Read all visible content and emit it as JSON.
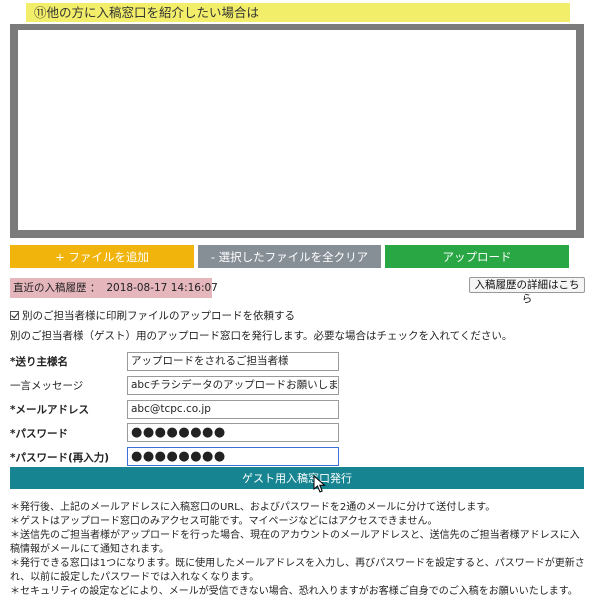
{
  "section": {
    "title": "⑪他の方に入稿窓口を紹介したい場合は"
  },
  "buttons": {
    "add_file": "+ ファイルを追加",
    "clear_selected": "- 選択したファイルを全クリア",
    "upload": "アップロード"
  },
  "recent": {
    "label": "直近の入稿履歴 ：",
    "timestamp": "2018-08-17 14:16:07",
    "details_button": "入稿履歴の詳細はこちら"
  },
  "request": {
    "checkbox_label": "別のご担当者様に印刷ファイルのアップロードを依頼する",
    "checked": true,
    "description": "別のご担当者様（ゲスト）用のアップロード窓口を発行します。必要な場合はチェックを入れてください。"
  },
  "form": {
    "sender_name": {
      "label": "*送り主様名",
      "value": "アップロードをされるご担当者様"
    },
    "message": {
      "label": "一言メッセージ",
      "value": "abcチラシデータのアップロードお願いします"
    },
    "email": {
      "label": "*メールアドレス",
      "value": "abc@tcpc.co.jp"
    },
    "password": {
      "label": "*パスワード",
      "value": "●●●●●●●●"
    },
    "password_confirm": {
      "label": "*パスワード(再入力)",
      "value": "●●●●●●●●"
    }
  },
  "guest_button": "ゲスト用入稿窓口発行",
  "notes": [
    "＊発行後、上記のメールアドレスに入稿窓口のURL、およびパスワードを2通のメールに分けて送付します。",
    "＊ゲストはアップロード窓口のみアクセス可能です。マイページなどにはアクセスできません。",
    "＊送信先のご担当者様がアップロードを行った場合、現在のアカウントのメールアドレスと、送信先のご担当者様アドレスに入稿情報がメールにて通知されます。",
    "＊発行できる窓口は1つになります。既に使用したメールアドレスを入力し、再びパスワードを設定すると、パスワードが更新され、以前に設定したパスワードでは入れなくなります。",
    "＊セキュリティの設定などにより、メールが受信できない場合、恐れ入りますがお客様ご自身でのご入稿をお願いいたします。"
  ],
  "colors": {
    "title_bg": "#f3ee6a",
    "add_button": "#f0b40c",
    "clear_button": "#868e96",
    "upload_button": "#2aa745",
    "recent_bg": "#e5b7bd",
    "guest_button": "#178591",
    "dropzone_border": "#7b7b7b"
  }
}
